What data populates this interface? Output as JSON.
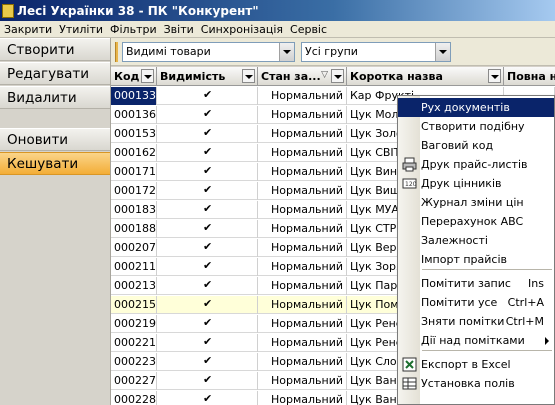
{
  "window": {
    "title": "Лесі Українки 38 - ПК \"Конкурент\""
  },
  "menu": [
    "Закрити",
    "Утиліти",
    "Фільтри",
    "Звіти",
    "Синхронізація",
    "Сервіс"
  ],
  "nav": {
    "create": "Створити",
    "edit": "Редагувати",
    "delete": "Видалити",
    "refresh": "Оновити",
    "cache": "Кешувати"
  },
  "filters": {
    "visibility": "Видимі товари",
    "groups": "Усі групи"
  },
  "grid": {
    "columns": [
      "Код",
      "Видимість",
      "Стан за...",
      "Коротка назва",
      "Повна н"
    ],
    "rows": [
      {
        "code": "000133",
        "visible": "✔",
        "state": "Нормальний",
        "name": "Кар Фрукті"
      },
      {
        "code": "000136",
        "visible": "✔",
        "state": "Нормальний",
        "name": "Цук Моло"
      },
      {
        "code": "000153",
        "visible": "✔",
        "state": "Нормальний",
        "name": "Цук Золо"
      },
      {
        "code": "000162",
        "visible": "✔",
        "state": "Нормальний",
        "name": "Цук СВІТ"
      },
      {
        "code": "000171",
        "visible": "✔",
        "state": "Нормальний",
        "name": "Цук Вино"
      },
      {
        "code": "000172",
        "visible": "✔",
        "state": "Нормальний",
        "name": "Цук Вишн"
      },
      {
        "code": "000183",
        "visible": "✔",
        "state": "Нормальний",
        "name": "Цук МУА"
      },
      {
        "code": "000188",
        "visible": "✔",
        "state": "Нормальний",
        "name": "Цук СТРІ"
      },
      {
        "code": "000207",
        "visible": "✔",
        "state": "Нормальний",
        "name": "Цук Верж"
      },
      {
        "code": "000211",
        "visible": "✔",
        "state": "Нормальний",
        "name": "Цук Зоря"
      },
      {
        "code": "000213",
        "visible": "✔",
        "state": "Нормальний",
        "name": "Цук Пари"
      },
      {
        "code": "000215",
        "visible": "✔",
        "state": "Нормальний",
        "name": "Цук Пома"
      },
      {
        "code": "000219",
        "visible": "✔",
        "state": "Нормальний",
        "name": "Цук Рене"
      },
      {
        "code": "000221",
        "visible": "✔",
        "state": "Нормальний",
        "name": "Цук Рене"
      },
      {
        "code": "000223",
        "visible": "✔",
        "state": "Нормальний",
        "name": "Цук Слоб"
      },
      {
        "code": "000227",
        "visible": "✔",
        "state": "Нормальний",
        "name": "Цук Вані"
      },
      {
        "code": "000228",
        "visible": "✔",
        "state": "Нормальний",
        "name": "Цук Вані"
      }
    ]
  },
  "context_menu": {
    "items": [
      {
        "label": "Рух документів",
        "shortcut": "",
        "icon": ""
      },
      {
        "label": "Створити подібну",
        "shortcut": "",
        "icon": ""
      },
      {
        "label": "Ваговий код",
        "shortcut": "",
        "icon": ""
      },
      {
        "label": "Друк прайс-листів",
        "shortcut": "",
        "icon": "printer-icon"
      },
      {
        "label": "Друк цінників",
        "shortcut": "",
        "icon": "price-tag-icon"
      },
      {
        "label": "Журнал зміни цін",
        "shortcut": "",
        "icon": ""
      },
      {
        "label": "Перерахунок ABC",
        "shortcut": "",
        "icon": ""
      },
      {
        "label": "Залежності",
        "shortcut": "",
        "icon": ""
      },
      {
        "label": "Імпорт прайсів",
        "shortcut": "",
        "icon": ""
      },
      {
        "label": "Помітити запис",
        "shortcut": "Ins",
        "icon": ""
      },
      {
        "label": "Помітити усе",
        "shortcut": "Ctrl+A",
        "icon": ""
      },
      {
        "label": "Зняти помітки",
        "shortcut": "Ctrl+M",
        "icon": ""
      },
      {
        "label": "Дії над помітками",
        "shortcut": "",
        "icon": ""
      },
      {
        "label": "Експорт в Excel",
        "shortcut": "",
        "icon": "excel-icon"
      },
      {
        "label": "Установка полів",
        "shortcut": "",
        "icon": "grid-settings-icon"
      }
    ]
  },
  "colors": {
    "selection": "#0a246a",
    "highlight_row": "#ffffd9",
    "active_nav": "#f3ad37"
  }
}
